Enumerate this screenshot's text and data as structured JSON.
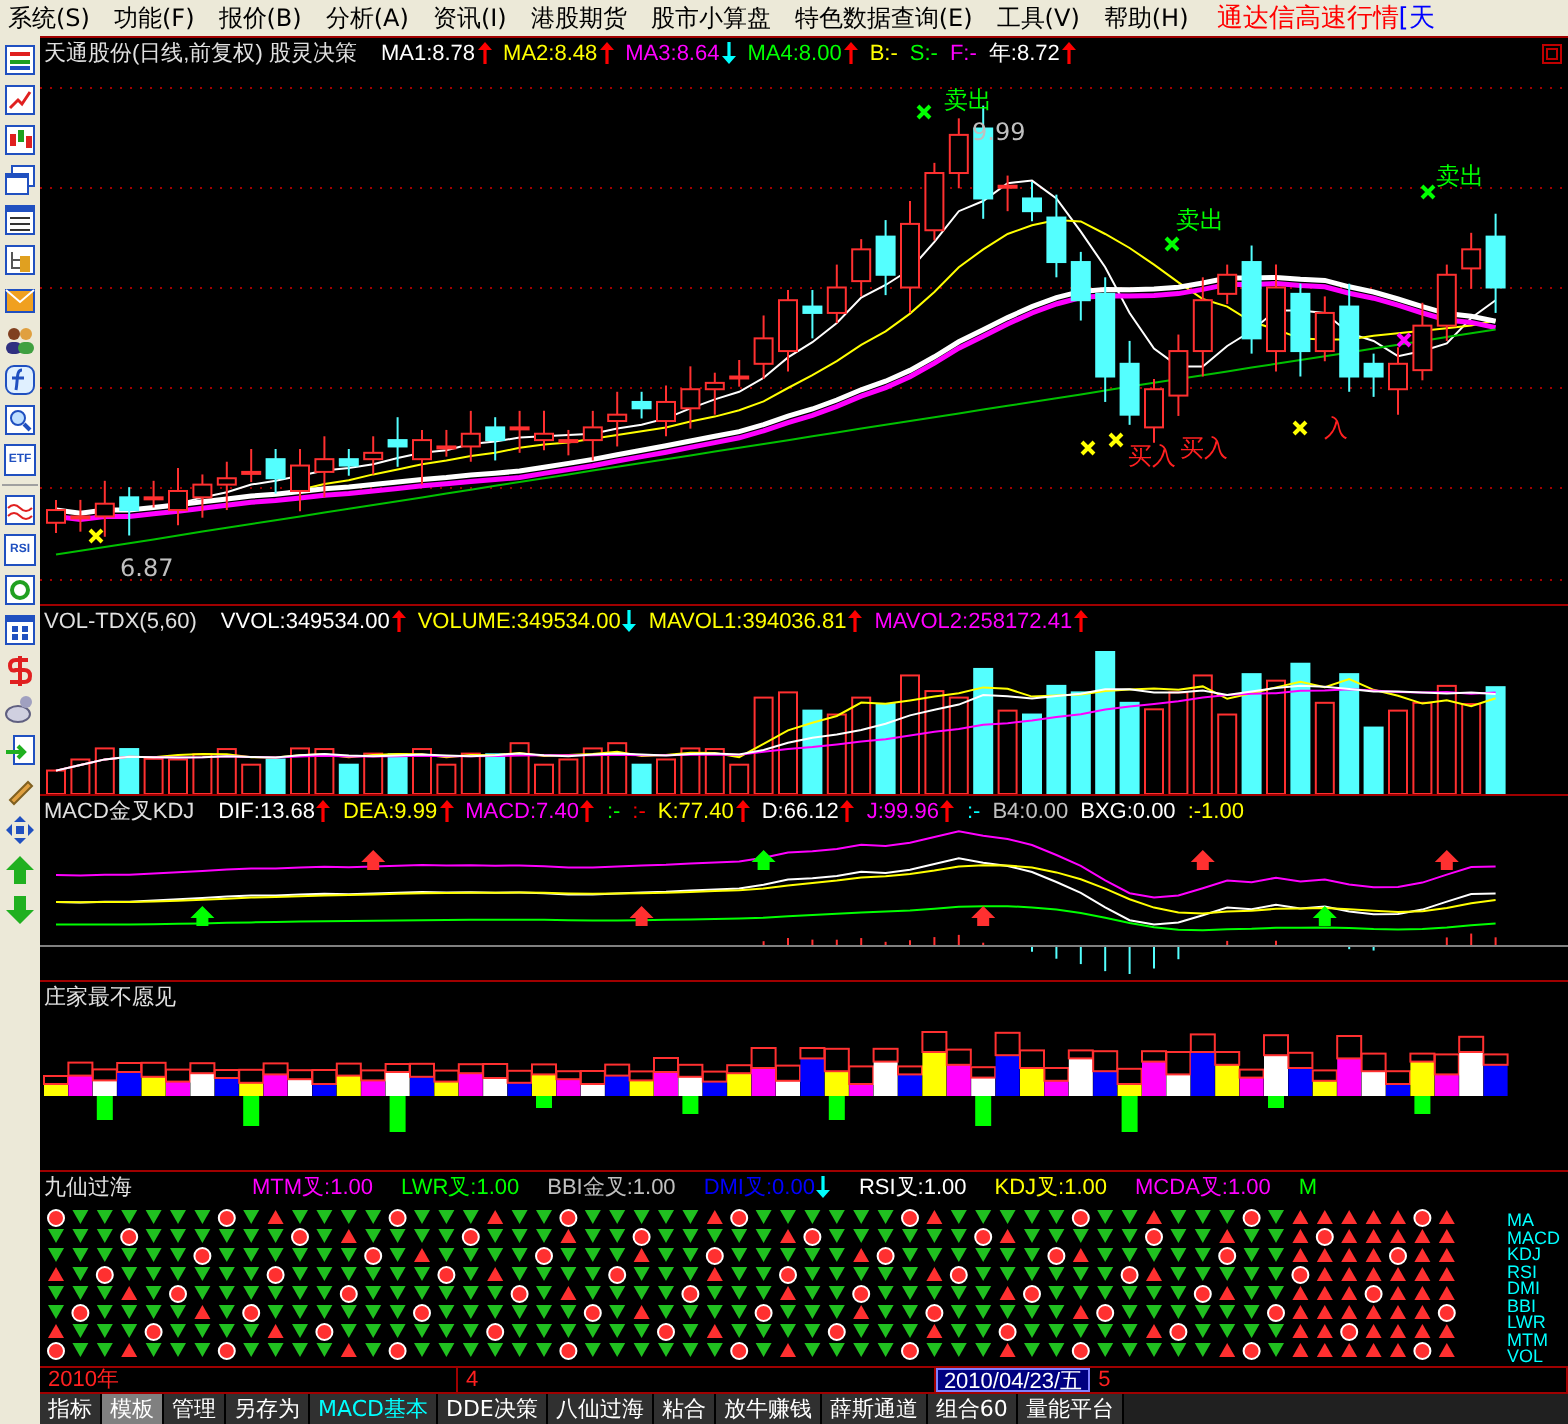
{
  "menu": [
    {
      "label": "系统(S)"
    },
    {
      "label": "功能(F)"
    },
    {
      "label": "报价(B)"
    },
    {
      "label": "分析(A)"
    },
    {
      "label": "资讯(I)"
    },
    {
      "label": "港股期货"
    },
    {
      "label": "股市小算盘"
    },
    {
      "label": "特色数据查询(E)"
    },
    {
      "label": "工具(V)"
    },
    {
      "label": "帮助(H)"
    }
  ],
  "brand": "通达信高速行情",
  "brand_cut": "[天",
  "toolbar": [
    {
      "kind": "table"
    },
    {
      "kind": "line"
    },
    {
      "kind": "candle"
    },
    {
      "kind": "windows"
    },
    {
      "kind": "list"
    },
    {
      "kind": "tree"
    },
    {
      "kind": "mail"
    },
    {
      "kind": "people"
    },
    {
      "kind": "function"
    },
    {
      "kind": "search"
    },
    {
      "kind": "text",
      "text": "ETF"
    },
    {
      "kind": "wave"
    },
    {
      "kind": "text",
      "text": "RSI"
    },
    {
      "kind": "refresh"
    },
    {
      "kind": "grid"
    },
    {
      "kind": "dollar"
    },
    {
      "kind": "satellite"
    },
    {
      "kind": "enter"
    },
    {
      "kind": "pencil"
    },
    {
      "kind": "move"
    },
    {
      "kind": "up"
    },
    {
      "kind": "down"
    }
  ],
  "price_panel": {
    "title": "天通股份(日线,前复权) 股灵决策",
    "indicators": [
      {
        "text": "MA1:8.78",
        "color": "#ffffff",
        "up_arrow": true,
        "down_arrow": false
      },
      {
        "text": "MA2:8.48",
        "color": "#ffff00",
        "up_arrow": true,
        "down_arrow": false
      },
      {
        "text": "MA3:8.64",
        "color": "#ff00ff",
        "up_arrow": false,
        "down_arrow": true
      },
      {
        "text": "MA4:8.00",
        "color": "#00ff00",
        "up_arrow": true,
        "down_arrow": false
      },
      {
        "text": "B:-",
        "color": "#ffff00",
        "up_arrow": false,
        "down_arrow": false
      },
      {
        "text": "S:-",
        "color": "#00ff00",
        "up_arrow": false,
        "down_arrow": false
      },
      {
        "text": "F:-",
        "color": "#ff00ff",
        "up_arrow": false,
        "down_arrow": false
      },
      {
        "text": "年:8.72",
        "color": "#ffffff",
        "up_arrow": true,
        "down_arrow": false
      }
    ],
    "annotations": [
      {
        "kind": "sell",
        "text": "卖出"
      },
      {
        "kind": "price",
        "text": "9.99"
      },
      {
        "kind": "sell",
        "text": "卖出"
      },
      {
        "kind": "sell",
        "text": "卖出"
      },
      {
        "kind": "buy",
        "text": "买入"
      },
      {
        "kind": "buy",
        "text": "买入"
      },
      {
        "kind": "buy",
        "text": "入"
      },
      {
        "kind": "price",
        "text": "6.87"
      }
    ]
  },
  "volume_panel": {
    "title": "VOL-TDX(5,60)",
    "indicators": [
      {
        "text": "VVOL:349534.00",
        "color": "#ffffff",
        "up_arrow": true,
        "down_arrow": false
      },
      {
        "text": "VOLUME:349534.00",
        "color": "#ffff00",
        "up_arrow": false,
        "down_arrow": true
      },
      {
        "text": "MAVOL1:394036.81",
        "color": "#ffff00",
        "up_arrow": true,
        "down_arrow": false
      },
      {
        "text": "MAVOL2:258172.41",
        "color": "#ff00ff",
        "up_arrow": true,
        "down_arrow": false
      }
    ]
  },
  "macd_panel": {
    "title": "MACD金叉KDJ",
    "indicators": [
      {
        "text": "DIF:13.68",
        "color": "#ffffff",
        "up_arrow": true,
        "down_arrow": false
      },
      {
        "text": "DEA:9.99",
        "color": "#ffff00",
        "up_arrow": true,
        "down_arrow": false
      },
      {
        "text": "MACD:7.40",
        "color": "#ff00ff",
        "up_arrow": true,
        "down_arrow": false
      },
      {
        "text": ":-",
        "color": "#00ff00",
        "up_arrow": false,
        "down_arrow": false
      },
      {
        "text": ":-",
        "color": "#ff0000",
        "up_arrow": false,
        "down_arrow": false
      },
      {
        "text": "K:77.40",
        "color": "#ffff00",
        "up_arrow": true,
        "down_arrow": false
      },
      {
        "text": "D:66.12",
        "color": "#ffffff",
        "up_arrow": true,
        "down_arrow": false
      },
      {
        "text": "J:99.96",
        "color": "#ff00ff",
        "up_arrow": true,
        "down_arrow": false
      },
      {
        "text": ":-",
        "color": "#00ffff",
        "up_arrow": false,
        "down_arrow": false
      },
      {
        "text": "B4:0.00",
        "color": "#c0c0c0",
        "up_arrow": false,
        "down_arrow": false
      },
      {
        "text": "BXG:0.00",
        "color": "#ffffff",
        "up_arrow": false,
        "down_arrow": false
      },
      {
        "text": ":-1.00",
        "color": "#ffff00",
        "up_arrow": false,
        "down_arrow": false
      }
    ]
  },
  "dealer_panel": {
    "title": "庄家最不愿见"
  },
  "nine_panel": {
    "title": "九仙过海",
    "indicators": [
      {
        "text": "MTM叉:1.00",
        "color": "#ff00ff",
        "up_arrow": false,
        "down_arrow": false
      },
      {
        "text": "LWR叉:1.00",
        "color": "#00ff00",
        "up_arrow": false,
        "down_arrow": false
      },
      {
        "text": "BBI金叉:1.00",
        "color": "#c0c0c0",
        "up_arrow": false,
        "down_arrow": false
      },
      {
        "text": "DMI叉:0.00",
        "color": "#0000ff",
        "up_arrow": false,
        "down_arrow": true
      },
      {
        "text": "RSI叉:1.00",
        "color": "#ffffff",
        "up_arrow": false,
        "down_arrow": false
      },
      {
        "text": "KDJ叉:1.00",
        "color": "#ffff00",
        "up_arrow": false,
        "down_arrow": false
      },
      {
        "text": "MCDA叉:1.00",
        "color": "#ff00ff",
        "up_arrow": false,
        "down_arrow": false
      },
      {
        "text": "M",
        "color": "#00ff00",
        "up_arrow": false,
        "down_arrow": false
      }
    ],
    "legend": [
      "MA",
      "MACD",
      "KDJ",
      "RSI",
      "DMI",
      "BBI",
      "LWR",
      "MTM",
      "VOL"
    ]
  },
  "date_bar": {
    "year": "2010年",
    "month": "4",
    "cursor_date": "2010/04/23/五",
    "next_month": "5"
  },
  "tabs": [
    {
      "label": "指标",
      "selected": false,
      "highlighted": false
    },
    {
      "label": "模板",
      "selected": true,
      "highlighted": false
    },
    {
      "label": "管理",
      "selected": false,
      "highlighted": false
    },
    {
      "label": "另存为",
      "selected": false,
      "highlighted": false
    },
    {
      "label": "MACD基本",
      "selected": false,
      "highlighted": true
    },
    {
      "label": "DDE决策",
      "selected": false,
      "highlighted": false
    },
    {
      "label": "八仙过海",
      "selected": false,
      "highlighted": false
    },
    {
      "label": "粘合",
      "selected": false,
      "highlighted": false
    },
    {
      "label": "放牛赚钱",
      "selected": false,
      "highlighted": false
    },
    {
      "label": "薛斯通道",
      "selected": false,
      "highlighted": false
    },
    {
      "label": "组合60",
      "selected": false,
      "highlighted": false
    },
    {
      "label": "量能平台",
      "selected": false,
      "highlighted": false
    }
  ]
}
